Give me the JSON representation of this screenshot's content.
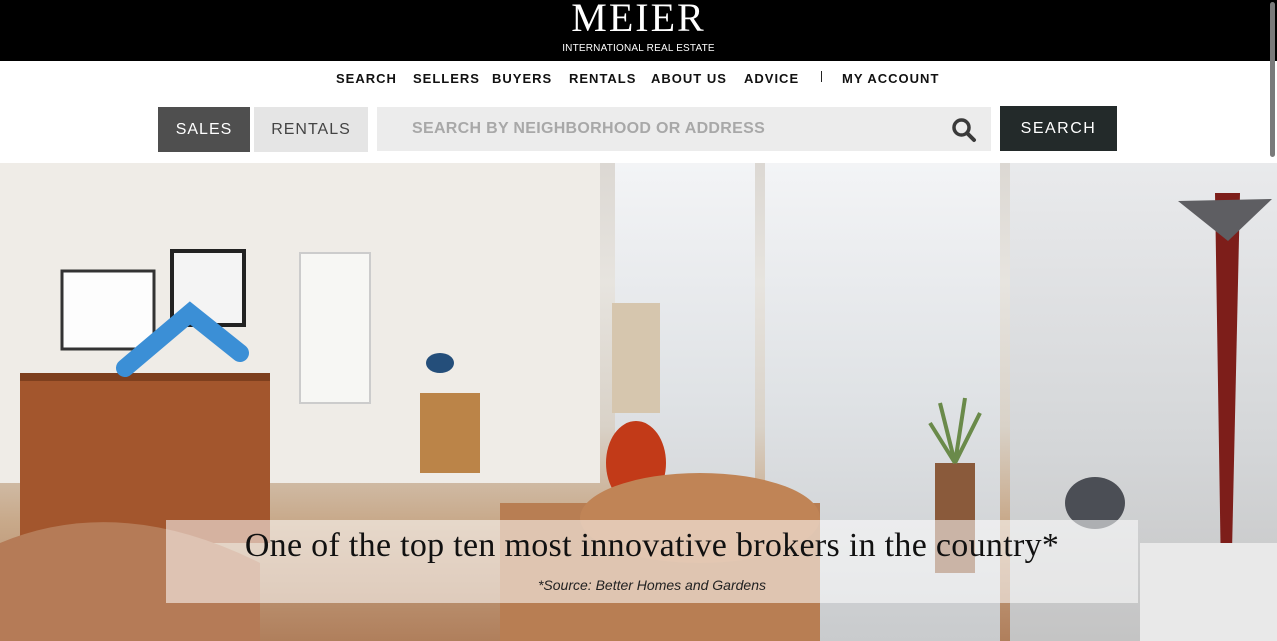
{
  "header": {
    "logo_word": "MEIER",
    "logo_sub": "INTERNATIONAL REAL ESTATE"
  },
  "nav": {
    "items": [
      "SEARCH",
      "SELLERS",
      "BUYERS",
      "RENTALS",
      "ABOUT US",
      "ADVICE"
    ],
    "account": "MY ACCOUNT"
  },
  "search": {
    "tab_sales": "SALES",
    "tab_rentals": "RENTALS",
    "placeholder": "SEARCH BY NEIGHBORHOOD OR ADDRESS",
    "button": "SEARCH",
    "active_tab": "SALES"
  },
  "hero": {
    "tagline": "One of the top ten most innovative brokers in the country*",
    "source": "*Source: Better Homes and Gardens"
  },
  "colors": {
    "header_bg": "#000000",
    "active_tab_bg": "#4f4f4f",
    "search_button_bg": "#232a2a"
  }
}
